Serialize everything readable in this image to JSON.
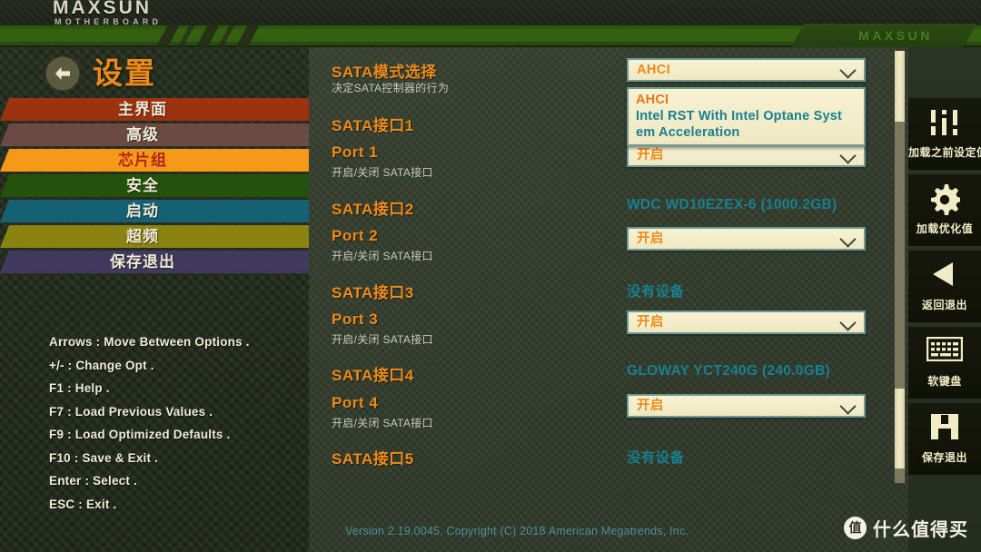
{
  "brand": {
    "name": "MAXSUN",
    "sub": "MOTHERBOARD",
    "band_logo": "MAXSUN"
  },
  "header": {
    "title": "设置",
    "back_icon": "back-arrow-icon"
  },
  "sidebar": {
    "items": [
      {
        "label": "主界面",
        "color": "#9c3210",
        "active": false
      },
      {
        "label": "高级",
        "color": "#6b4a44",
        "active": false
      },
      {
        "label": "芯片组",
        "color": "#f59a18",
        "active": true
      },
      {
        "label": "安全",
        "color": "#24520d",
        "active": false
      },
      {
        "label": "启动",
        "color": "#156173",
        "active": false
      },
      {
        "label": "超频",
        "color": "#8a8211",
        "active": false
      },
      {
        "label": "保存退出",
        "color": "#42395f",
        "active": false
      }
    ],
    "help": [
      "Arrows : Move Between Options .",
      "+/- : Change Opt .",
      "F1 : Help .",
      "F7 : Load Previous Values .",
      "F9 : Load Optimized Defaults .",
      "F10 : Save & Exit .",
      "Enter : Select .",
      "ESC : Exit ."
    ]
  },
  "main": {
    "sata_mode": {
      "name": "SATA模式选择",
      "desc": "决定SATA控制器的行为",
      "value": "AHCI",
      "options": [
        {
          "label": "AHCI",
          "selected": true
        },
        {
          "label": "Intel RST With Intel Optane Syst",
          "selected": false
        },
        {
          "label": "em Acceleration",
          "selected": false
        }
      ]
    },
    "ports": [
      {
        "header": "SATA接口1",
        "device": "",
        "port_name": "Port 1",
        "port_desc": "开启/关闭 SATA接口",
        "port_value": "开启"
      },
      {
        "header": "SATA接口2",
        "device": "WDC WD10EZEX-6 (1000.2GB)",
        "port_name": "Port 2",
        "port_desc": "开启/关闭 SATA接口",
        "port_value": "开启"
      },
      {
        "header": "SATA接口3",
        "device": "没有设备",
        "port_name": "Port 3",
        "port_desc": "开启/关闭 SATA接口",
        "port_value": "开启"
      },
      {
        "header": "SATA接口4",
        "device": "GLOWAY YCT240G (240.0GB)",
        "port_name": "Port 4",
        "port_desc": "开启/关闭 SATA接口",
        "port_value": "开启"
      },
      {
        "header": "SATA接口5",
        "device": "没有设备",
        "port_name": "",
        "port_desc": "",
        "port_value": ""
      }
    ]
  },
  "rail": [
    {
      "label": "加载之前设定值",
      "icon": "sliders-icon"
    },
    {
      "label": "加载优化值",
      "icon": "gear-icon"
    },
    {
      "label": "返回退出",
      "icon": "back-triangle-icon"
    },
    {
      "label": "软键盘",
      "icon": "keyboard-icon"
    },
    {
      "label": "保存退出",
      "icon": "floppy-save-icon"
    }
  ],
  "footer": {
    "version": "Version 2.19.0045. Copyright (C) 2018 American Megatrends, Inc."
  },
  "watermark": {
    "badge": "值",
    "text": "什么值得买"
  },
  "colors": {
    "accent_orange": "#ef8a18",
    "teal": "#1a7f8e",
    "cream": "#f5efcb",
    "band_green": "#356011"
  }
}
